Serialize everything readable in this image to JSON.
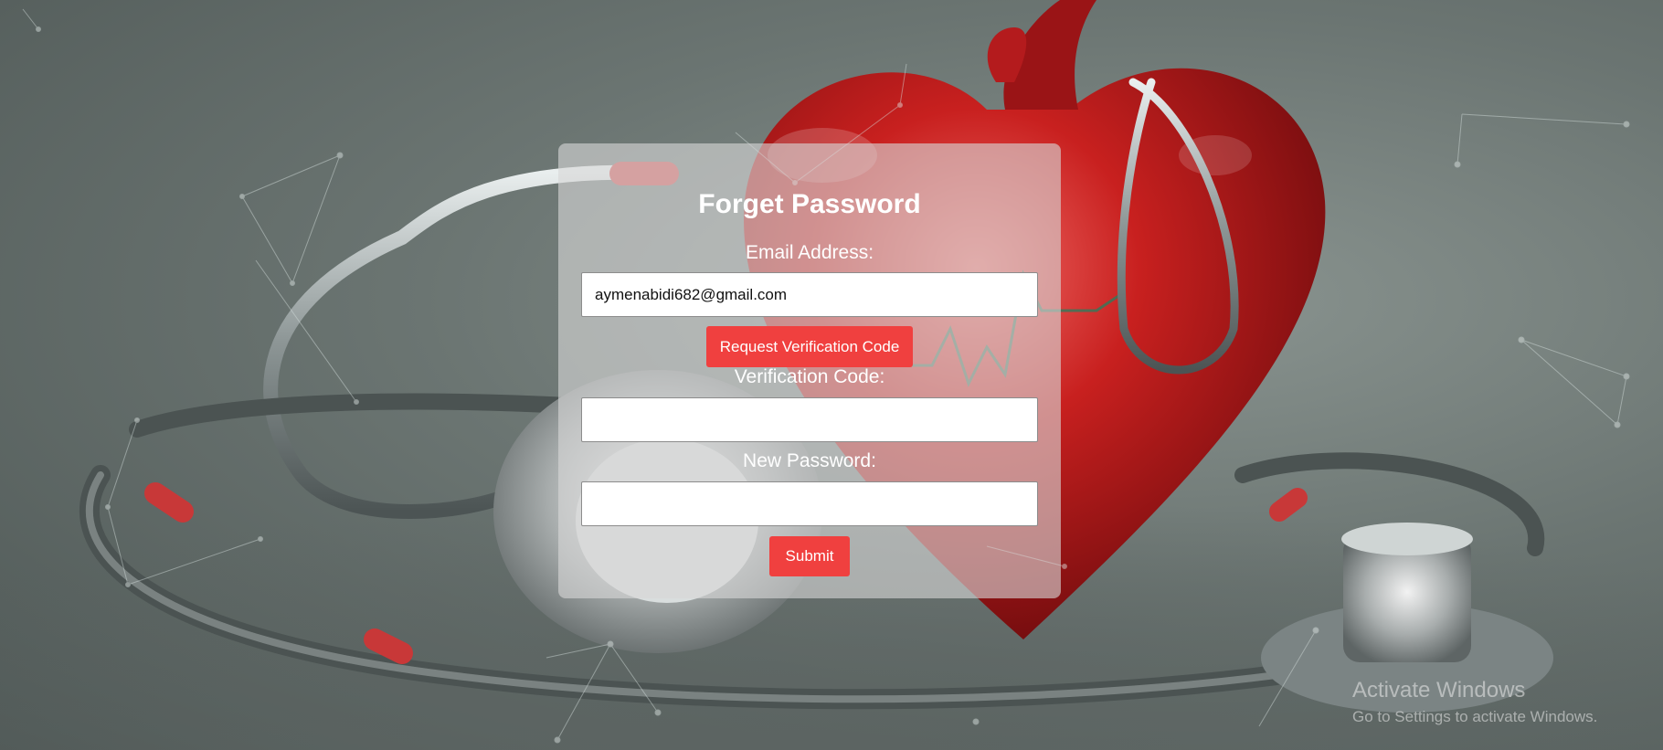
{
  "form": {
    "title": "Forget Password",
    "email_label": "Email Address:",
    "email_value": "aymenabidi682@gmail.com",
    "request_button": "Request Verification Code",
    "code_label": "Verification Code:",
    "code_value": "",
    "password_label": "New Password:",
    "password_value": "",
    "submit_button": "Submit"
  },
  "watermark": {
    "title": "Activate Windows",
    "subtitle": "Go to Settings to activate Windows."
  },
  "colors": {
    "button": "#f0403f",
    "card": "rgba(215,215,215,0.62)",
    "text": "#ffffff"
  },
  "background": {
    "icons": [
      "heart-icon",
      "stethoscope-icon",
      "network-lines"
    ]
  }
}
